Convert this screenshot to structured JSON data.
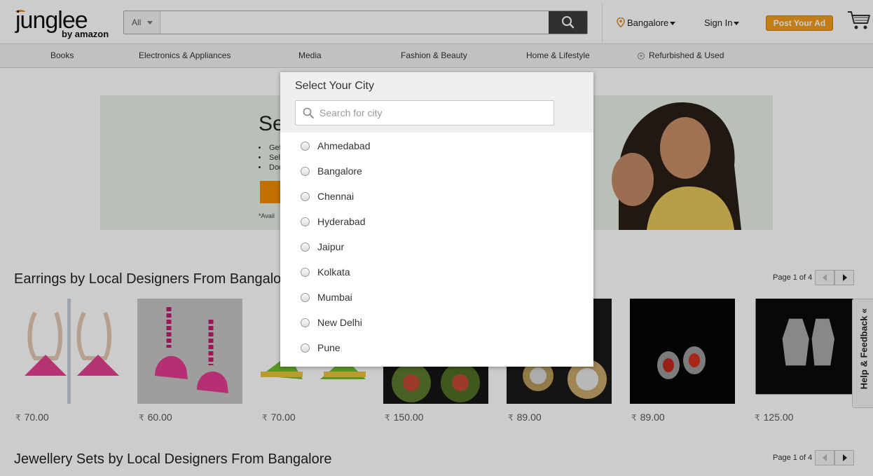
{
  "header": {
    "logo_text": "junglee",
    "logo_sub": "by amazon",
    "search": {
      "category": "All",
      "placeholder": "",
      "value": ""
    },
    "location": "Bangalore",
    "sign_in": "Sign In",
    "post_ad": "Post Your Ad",
    "icons": [
      "search-icon",
      "location-pin-icon",
      "cart-icon"
    ]
  },
  "nav": {
    "items": [
      {
        "label": "Books"
      },
      {
        "label": "Electronics & Appliances"
      },
      {
        "label": "Media"
      },
      {
        "label": "Fashion & Beauty"
      },
      {
        "label": "Home & Lifestyle"
      },
      {
        "label": "Refurbished & Used"
      }
    ]
  },
  "banner": {
    "title_fragment": "Se",
    "bullets": [
      "Get",
      "Sel",
      "Doo"
    ],
    "note": "*Avail"
  },
  "sections": [
    {
      "title": "Earrings by Local Designers From Bangalore",
      "pager": "Page 1 of 4"
    },
    {
      "title": "Jewellery Sets by Local Designers From Bangalore",
      "pager": "Page 1 of 4"
    }
  ],
  "products": [
    {
      "currency": "₹",
      "price": "70.00"
    },
    {
      "currency": "₹",
      "price": "60.00"
    },
    {
      "currency": "₹",
      "price": "70.00"
    },
    {
      "currency": "₹",
      "price": "150.00"
    },
    {
      "currency": "₹",
      "price": "89.00"
    },
    {
      "currency": "₹",
      "price": "89.00"
    },
    {
      "currency": "₹",
      "price": "125.00"
    }
  ],
  "city_modal": {
    "title": "Select Your City",
    "search_placeholder": "Search for city",
    "cities": [
      "Ahmedabad",
      "Bangalore",
      "Chennai",
      "Hyderabad",
      "Jaipur",
      "Kolkata",
      "Mumbai",
      "New Delhi",
      "Pune"
    ]
  },
  "feedback_tab": {
    "label": "Help & Feedback «"
  },
  "colors": {
    "accent": "#f49d1d",
    "search_button": "#3d3d3d",
    "banner_bg": "#e6f0e6"
  }
}
